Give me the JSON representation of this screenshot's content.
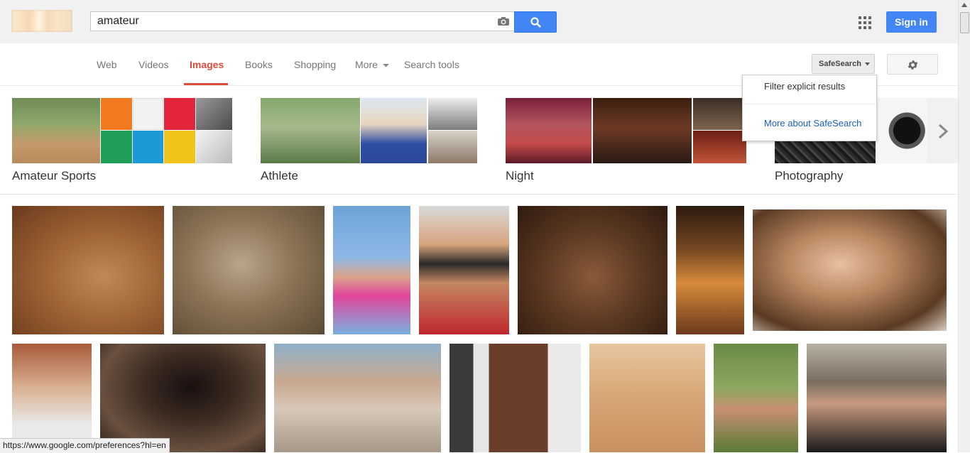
{
  "search": {
    "query": "amateur"
  },
  "header": {
    "signin_label": "Sign in"
  },
  "tabs": [
    {
      "label": "Web"
    },
    {
      "label": "Videos"
    },
    {
      "label": "Images"
    },
    {
      "label": "Books"
    },
    {
      "label": "Shopping"
    },
    {
      "label": "More"
    },
    {
      "label": "Search tools"
    }
  ],
  "active_tab": "Images",
  "safesearch": {
    "button_label": "SafeSearch",
    "menu": {
      "filter_label": "Filter explicit results",
      "more_label": "More about SafeSearch"
    }
  },
  "related": [
    {
      "label": "Amateur Sports"
    },
    {
      "label": "Athlete"
    },
    {
      "label": "Night"
    },
    {
      "label": "Photography"
    }
  ],
  "status_bar": {
    "url": "https://www.google.com/preferences?hl=en"
  },
  "colors": {
    "accent_blue": "#4285f4",
    "active_tab_red": "#dd4b39",
    "link_blue": "#1a5fbf"
  },
  "icons": [
    "logo",
    "camera-icon",
    "search-icon",
    "apps-grid-icon",
    "gear-icon",
    "chevron-down-icon",
    "chevron-right-icon"
  ]
}
